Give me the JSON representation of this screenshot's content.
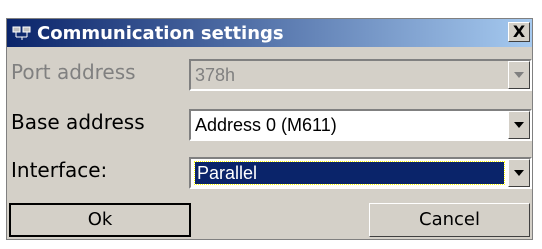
{
  "window": {
    "title": "Communication settings",
    "close_label": "X"
  },
  "fields": {
    "port_address": {
      "label": "Port address",
      "value": "378h"
    },
    "base_address": {
      "label": "Base address",
      "value": "Address 0 (M611)"
    },
    "interface": {
      "label": "Interface:",
      "value": "Parallel"
    }
  },
  "buttons": {
    "ok": "Ok",
    "cancel": "Cancel"
  },
  "icons": {
    "app": "network-icon",
    "dropdown": "chevron-down-icon"
  },
  "colors": {
    "titlebar_start": "#0a246a",
    "titlebar_end": "#a6caf0",
    "selection": "#0a246a",
    "dialog_bg": "#d4d0c8"
  }
}
